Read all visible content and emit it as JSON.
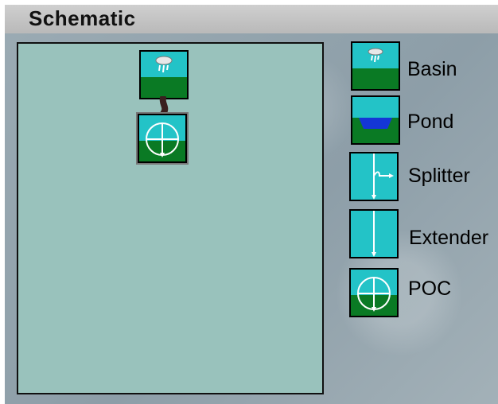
{
  "window": {
    "title": "Schematic"
  },
  "schematic": {
    "nodes": [
      {
        "type": "basin",
        "icon": "basin-icon"
      },
      {
        "type": "poc",
        "icon": "poc-icon"
      }
    ]
  },
  "palette": {
    "items": [
      {
        "label": "Basin",
        "icon": "basin-icon"
      },
      {
        "label": "Pond",
        "icon": "pond-icon"
      },
      {
        "label": "Splitter",
        "icon": "splitter-icon"
      },
      {
        "label": "Extender",
        "icon": "extender-icon"
      },
      {
        "label": "POC",
        "icon": "poc-icon"
      }
    ]
  },
  "colors": {
    "canvas": "#99c2bc",
    "sky": "#23c3c7",
    "ground": "#0a7a24",
    "water": "#1436d6"
  }
}
